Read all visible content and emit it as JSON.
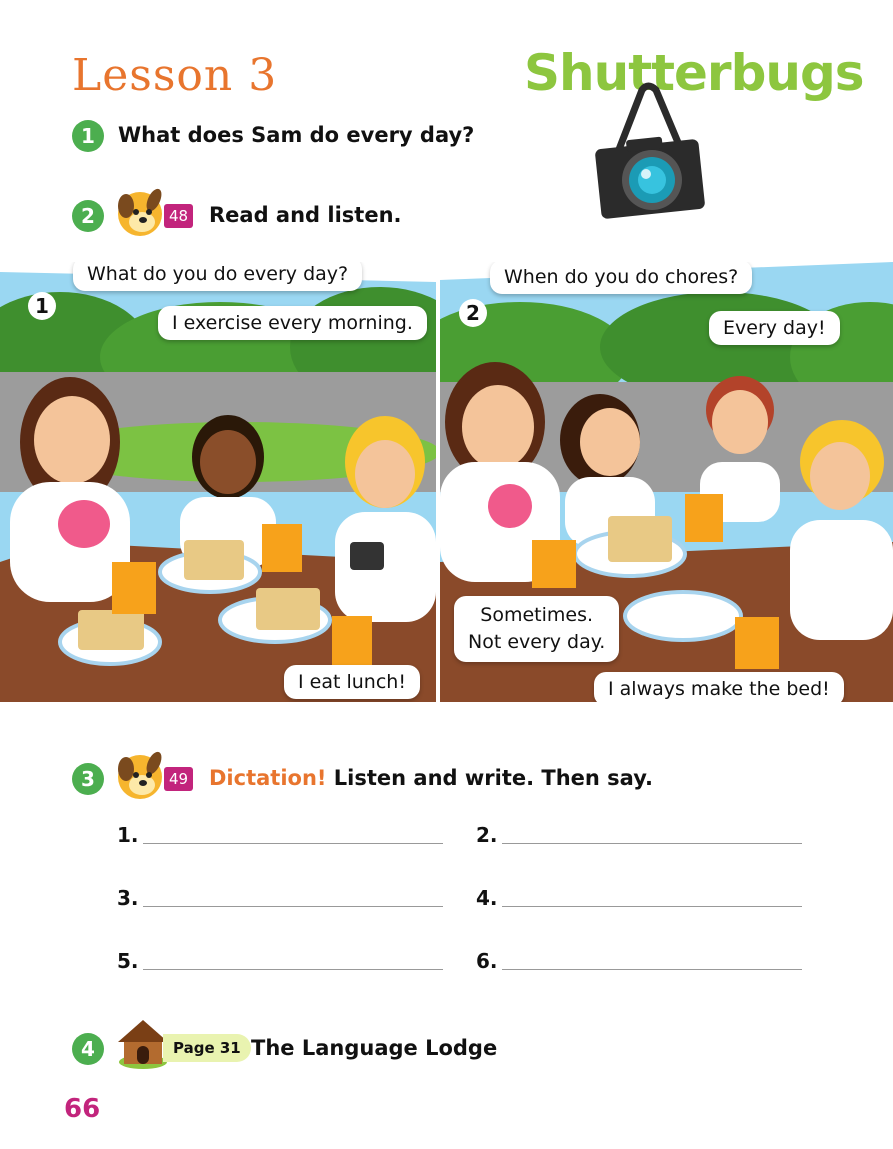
{
  "header": {
    "lesson": "Lesson 3",
    "unit": "Shutterbugs"
  },
  "q1": {
    "number": "1",
    "text": "What does Sam do every day?"
  },
  "q2": {
    "number": "2",
    "track": "48",
    "text": "Read and listen."
  },
  "panel1": {
    "number": "1",
    "bubbles": [
      "What do you do every day?",
      "I exercise every morning.",
      "I eat lunch!"
    ]
  },
  "panel2": {
    "number": "2",
    "bubbles": [
      "When do you do chores?",
      "Every day!",
      "Sometimes.\nNot every day.",
      "I always make the bed!"
    ]
  },
  "q3": {
    "number": "3",
    "track": "49",
    "highlight": "Dictation!",
    "text": "Listen and write. Then say.",
    "lines": [
      "1.",
      "2.",
      "3.",
      "4.",
      "5.",
      "6."
    ]
  },
  "q4": {
    "number": "4",
    "page_ref": "Page 31",
    "text": "The Language Lodge"
  },
  "footer": {
    "page_number": "66"
  },
  "colors": {
    "lesson": "#e8752e",
    "unit": "#8dc63f",
    "circle": "#4cae4f",
    "track": "#c2247c",
    "page_number": "#c2247c"
  }
}
